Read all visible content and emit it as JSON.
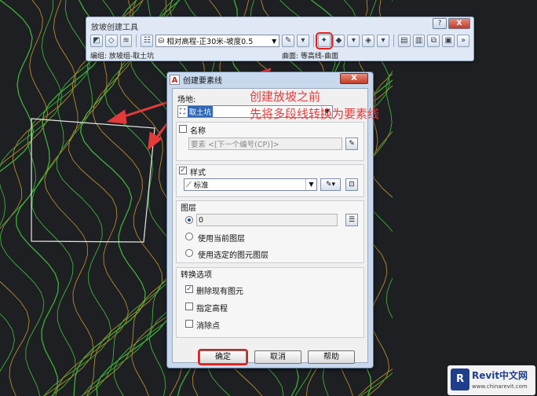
{
  "toolbar_window": {
    "title": "放坡创建工具",
    "criteria_value": "相对高程-正30米-坡度0.5",
    "status_group": "编组: 放坡组-取土坑",
    "status_surface": "曲面: 等高线-曲面",
    "help_glyph": "?",
    "close_glyph": "X"
  },
  "dialog": {
    "title": "创建要素线",
    "close_glyph": "X",
    "site_label": "场地:",
    "site_value": "取土坑",
    "name_label": "名称",
    "name_checked": false,
    "name_value": "要素 <[下一个编号(CP)]>",
    "style_label": "样式",
    "style_checked": true,
    "style_value": "标准",
    "layer_label": "图层",
    "layer_value": "0",
    "radio_current": "使用当前图层",
    "radio_selected": "使用选定的图元图层",
    "conversion_label": "转换选项",
    "opt_delete": "删除现有图元",
    "opt_delete_checked": true,
    "opt_elev": "指定高程",
    "opt_elev_checked": false,
    "opt_weed": "消除点",
    "opt_weed_checked": false,
    "ok_label": "确定",
    "cancel_label": "取消",
    "help_label": "帮助"
  },
  "annotation": {
    "line1": "创建放坡之前",
    "line2": "先将多段线转换为要素线"
  },
  "watermark": {
    "brand": "Revit中文网",
    "url": "www.chinarevit.com",
    "logo_letter": "R"
  },
  "colors": {
    "canvas_bg": "#1d1f22",
    "contour_green": "#3fb03a",
    "contour_orange": "#b58a2e",
    "annotation_red": "#e53a3a",
    "dialog_bg": "#c8d9ee"
  }
}
